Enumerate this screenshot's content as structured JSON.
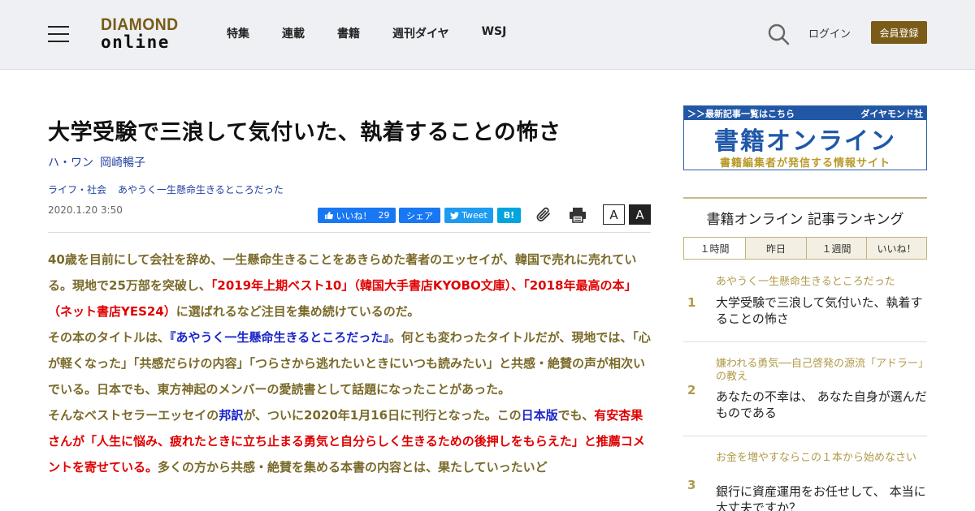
{
  "header": {
    "logo_top": "DIAMOND",
    "logo_bottom": "online",
    "nav": [
      "特集",
      "連載",
      "書籍",
      "週刊ダイヤ",
      "WSJ"
    ],
    "login": "ログイン",
    "register": "会員登録"
  },
  "article": {
    "title": "大学受験で三浪して気付いた、執着することの怖さ",
    "authors": [
      "ハ・ワン",
      "岡崎暢子"
    ],
    "categories": [
      "ライフ・社会",
      "あやうく一生懸命生きるところだった"
    ],
    "date": "2020.1.20 3:50",
    "social": {
      "like": "いいね！",
      "like_count": "29",
      "share": "シェア",
      "tweet": "Tweet",
      "hatena": "B!"
    },
    "font_small": "A",
    "font_large": "A",
    "p1": [
      "40歳を目前にして会社を辞め、一生懸命生きることをあきらめた著者のエッセイが、韓国で売れに売れている。現地で25万部を突破し、",
      "「2019年上期ベスト10」（韓国大手書店KYOBO文庫）、「2018年最高の本」（ネット書店YES24）",
      "に選ばれるなど注目を集め続けているのだ。"
    ],
    "p2": [
      "その本のタイトルは、",
      "『あやうく一生懸命生きるところだった』",
      "。何とも変わったタイトルだが、現地では、「心が軽くなった」「共感だらけの内容」「つらさから逃れたいときにいつも読みたい」と共感・絶賛の声が相次いでいる。日本でも、東方神起のメンバーの愛読書として話題になったことがあった。"
    ],
    "p3": [
      "そんなベストセラーエッセイの",
      "邦訳",
      "が、ついに2020年1月16日に刊行となった。この",
      "日本版",
      "でも、",
      "有安杏果さんが「人生に悩み、疲れたときに立ち止まる勇気と自分らしく生きるための後押しをもらえた」と推薦コメントを寄せている。",
      "多くの方から共感・絶賛を集める本書の内容とは、果たしていったいど"
    ]
  },
  "sidebar": {
    "banner": {
      "link": "＞＞最新記事一覧はこちら",
      "publisher": "ダイヤモンド社",
      "title": "書籍オンライン",
      "subtitle": "書籍編集者が発信する情報サイト"
    },
    "ranking_title": "書籍オンライン 記事ランキング",
    "tabs": [
      "１時間",
      "昨日",
      "１週間",
      "いいね！"
    ],
    "items": [
      {
        "rank": "1",
        "category": "あやうく一生懸命生きるところだった",
        "headline": "大学受験で三浪して気付いた、執着することの怖さ"
      },
      {
        "rank": "2",
        "category": "嫌われる勇気──自己啓発の源流「アドラー」の教え",
        "headline": "あなたの不幸は、 あなた自身が選んだものである"
      },
      {
        "rank": "3",
        "category": "お金を増やすならこの１本から始めなさい",
        "headline": "銀行に資産運用をお任せして、 本当に大丈夫ですか？"
      }
    ]
  }
}
